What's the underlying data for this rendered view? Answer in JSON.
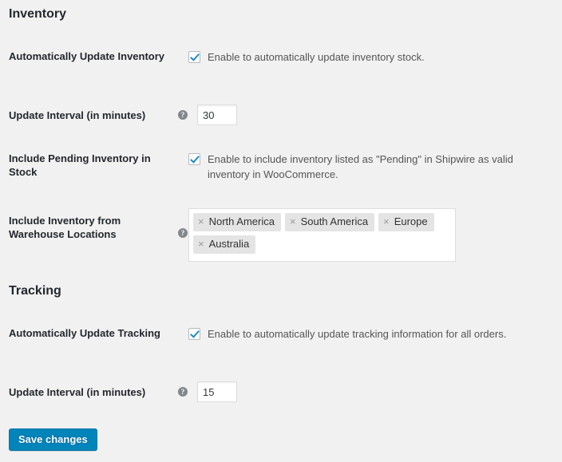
{
  "sections": [
    {
      "id": "inventory",
      "heading": "Inventory",
      "rows": [
        {
          "id": "auto-update-inventory",
          "label": "Automatically Update Inventory",
          "type": "checkbox",
          "checked": true,
          "description": "Enable to automatically update inventory stock.",
          "has_help": false
        },
        {
          "id": "inventory-update-interval",
          "label": "Update Interval (in minutes)",
          "type": "text",
          "value": "30",
          "has_help": true,
          "help_icon": "help-question-icon"
        },
        {
          "id": "include-pending-inventory",
          "label": "Include Pending Inventory in Stock",
          "type": "checkbox",
          "checked": true,
          "description": "Enable to include inventory listed as \"Pending\" in Shipwire as valid inventory in WooCommerce.",
          "has_help": false
        },
        {
          "id": "warehouse-locations",
          "label": "Include Inventory from Warehouse Locations",
          "type": "multiselect",
          "has_help": true,
          "help_icon": "help-question-icon",
          "tags": [
            {
              "label": "North America",
              "remove": "×"
            },
            {
              "label": "South America",
              "remove": "×"
            },
            {
              "label": "Europe",
              "remove": "×"
            },
            {
              "label": "Australia",
              "remove": "×"
            }
          ]
        }
      ]
    },
    {
      "id": "tracking",
      "heading": "Tracking",
      "rows": [
        {
          "id": "auto-update-tracking",
          "label": "Automatically Update Tracking",
          "type": "checkbox",
          "checked": true,
          "description": "Enable to automatically update tracking information for all orders.",
          "has_help": false
        },
        {
          "id": "tracking-update-interval",
          "label": "Update Interval (in minutes)",
          "type": "text",
          "value": "15",
          "has_help": true,
          "help_icon": "help-question-icon"
        }
      ]
    }
  ],
  "help_glyph": "?",
  "submit": {
    "label": "Save changes"
  },
  "colors": {
    "page_background": "#f1f1f1",
    "heading_text": "#23282d",
    "body_text": "#555555",
    "primary_button": "#0085ba",
    "checkbox_check": "#1e8cbe",
    "help_icon": "#82878c",
    "tag_background": "#e4e4e4",
    "input_border": "#dddddd"
  }
}
